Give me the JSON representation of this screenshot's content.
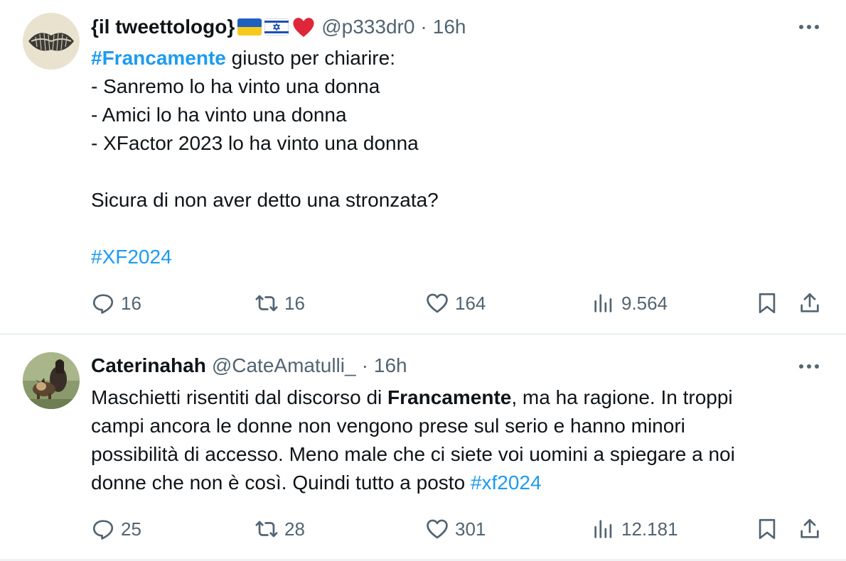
{
  "tweets": [
    {
      "display_name": "{il tweettologo}",
      "handle": "@p333dr0",
      "separator": "·",
      "time": "16h",
      "lines": {
        "l1_tag": "#Francamente",
        "l1_text": " giusto per chiarire:",
        "l2": "- Sanremo lo ha vinto una donna",
        "l3": "- Amici lo ha vinto una donna",
        "l4": "- XFactor 2023 lo ha vinto una donna",
        "l6": "Sicura di non aver detto una stronzata?",
        "l8_tag": "#XF2024"
      },
      "stats": {
        "replies": "16",
        "retweets": "16",
        "likes": "164",
        "views": "9.564"
      }
    },
    {
      "display_name": "Caterinahah",
      "handle": "@CateAmatulli_",
      "separator": "·",
      "time": "16h",
      "lines": {
        "l1_a": "Maschietti risentiti dal discorso di ",
        "l1_bold": "Francamente",
        "l1_b": ", ma ha ragione. In troppi",
        "l2": "campi ancora le donne non vengono prese sul serio e hanno minori",
        "l3": "possibilità di accesso. Meno male che ci siete voi uomini a spiegare a noi",
        "l4_text": "donne che non è così. Quindi tutto a posto ",
        "l4_tag": "#xf2024"
      },
      "stats": {
        "replies": "25",
        "retweets": "28",
        "likes": "301",
        "views": "12.181"
      }
    }
  ],
  "colors": {
    "text": "#0f1419",
    "secondary": "#536471",
    "link": "#1d9bf0",
    "divider": "#eff3f4"
  },
  "icons": [
    "more-icon",
    "reply-icon",
    "retweet-icon",
    "like-icon",
    "views-icon",
    "bookmark-icon",
    "share-icon",
    "ukraine-flag-icon",
    "israel-flag-icon",
    "heart-emoji-icon"
  ]
}
